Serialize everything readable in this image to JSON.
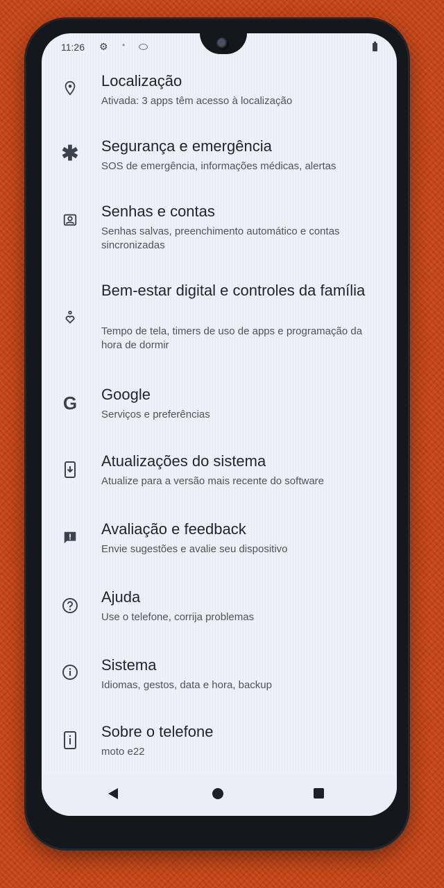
{
  "status_bar": {
    "time": "11:26",
    "icons": [
      "gear-icon",
      "dot-icon",
      "eye-icon",
      "battery-icon"
    ]
  },
  "settings": {
    "items": [
      {
        "icon": "location-pin-icon",
        "title": "Localização",
        "subtitle": "Ativada: 3 apps têm acesso à localização"
      },
      {
        "icon": "asterisk-icon",
        "title": "Segurança e emergência",
        "subtitle": "SOS de emergência, informações médicas, alertas"
      },
      {
        "icon": "account-box-icon",
        "title": "Senhas e contas",
        "subtitle": "Senhas salvas, preenchimento automático e contas sincronizadas"
      },
      {
        "icon": "wellbeing-heart-icon",
        "title": "Bem-estar digital e controles da família",
        "subtitle": "Tempo de tela, timers de uso de apps e programação da hora de dormir"
      },
      {
        "icon": "google-g-icon",
        "title": "Google",
        "subtitle": "Serviços e preferências"
      },
      {
        "icon": "system-update-icon",
        "title": "Atualizações do sistema",
        "subtitle": "Atualize para a versão mais recente do software"
      },
      {
        "icon": "feedback-icon",
        "title": "Avaliação e feedback",
        "subtitle": "Envie sugestões e avalie seu dispositivo"
      },
      {
        "icon": "help-icon",
        "title": "Ajuda",
        "subtitle": "Use o telefone, corrija problemas"
      },
      {
        "icon": "info-icon",
        "title": "Sistema",
        "subtitle": "Idiomas, gestos, data e hora, backup"
      },
      {
        "icon": "phone-info-icon",
        "title": "Sobre o telefone",
        "subtitle": "moto e22"
      }
    ]
  },
  "nav_bar": {
    "buttons": [
      "back-icon",
      "home-icon",
      "recents-icon"
    ]
  }
}
